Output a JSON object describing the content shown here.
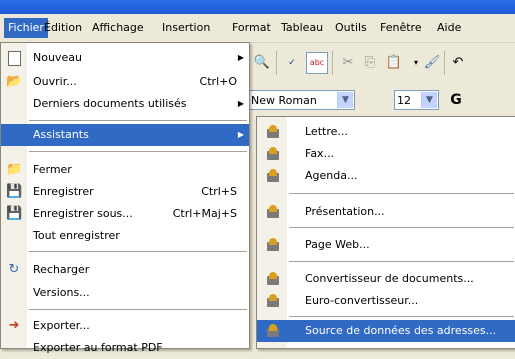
{
  "menubar": {
    "items": [
      "Fichier",
      "Édition",
      "Affichage",
      "Insertion",
      "Format",
      "Tableau",
      "Outils",
      "Fenêtre",
      "Aide"
    ]
  },
  "toolbar": {
    "font_name": "New Roman",
    "font_size": "12",
    "bold_label": "G"
  },
  "fichier_menu": {
    "items": [
      {
        "label": "Nouveau",
        "shortcut": "",
        "submenu": true,
        "icon": "new-document-icon"
      },
      {
        "label": "Ouvrir...",
        "shortcut": "Ctrl+O",
        "submenu": false,
        "icon": "open-folder-icon"
      },
      {
        "label": "Derniers documents utilisés",
        "shortcut": "",
        "submenu": true,
        "icon": ""
      },
      {
        "label": "Assistants",
        "shortcut": "",
        "submenu": true,
        "icon": ""
      },
      {
        "label": "Fermer",
        "shortcut": "",
        "submenu": false,
        "icon": "close-folder-icon"
      },
      {
        "label": "Enregistrer",
        "shortcut": "Ctrl+S",
        "submenu": false,
        "icon": "save-icon"
      },
      {
        "label": "Enregistrer sous...",
        "shortcut": "Ctrl+Maj+S",
        "submenu": false,
        "icon": "save-as-icon"
      },
      {
        "label": "Tout enregistrer",
        "shortcut": "",
        "submenu": false,
        "icon": ""
      },
      {
        "label": "Recharger",
        "shortcut": "",
        "submenu": false,
        "icon": "reload-icon"
      },
      {
        "label": "Versions...",
        "shortcut": "",
        "submenu": false,
        "icon": ""
      },
      {
        "label": "Exporter...",
        "shortcut": "",
        "submenu": false,
        "icon": "export-icon"
      },
      {
        "label": "Exporter au format PDF",
        "shortcut": "",
        "submenu": false,
        "icon": ""
      }
    ]
  },
  "assistants_menu": {
    "items": [
      {
        "label": "Lettre..."
      },
      {
        "label": "Fax..."
      },
      {
        "label": "Agenda..."
      },
      {
        "label": "Présentation..."
      },
      {
        "label": "Page Web..."
      },
      {
        "label": "Convertisseur de documents..."
      },
      {
        "label": "Euro-convertisseur..."
      },
      {
        "label": "Source de données des adresses..."
      }
    ]
  },
  "colors": {
    "highlight": "#316ac5",
    "menubar_bg": "#ece9d8",
    "title_blue": "#2b6fe6"
  }
}
